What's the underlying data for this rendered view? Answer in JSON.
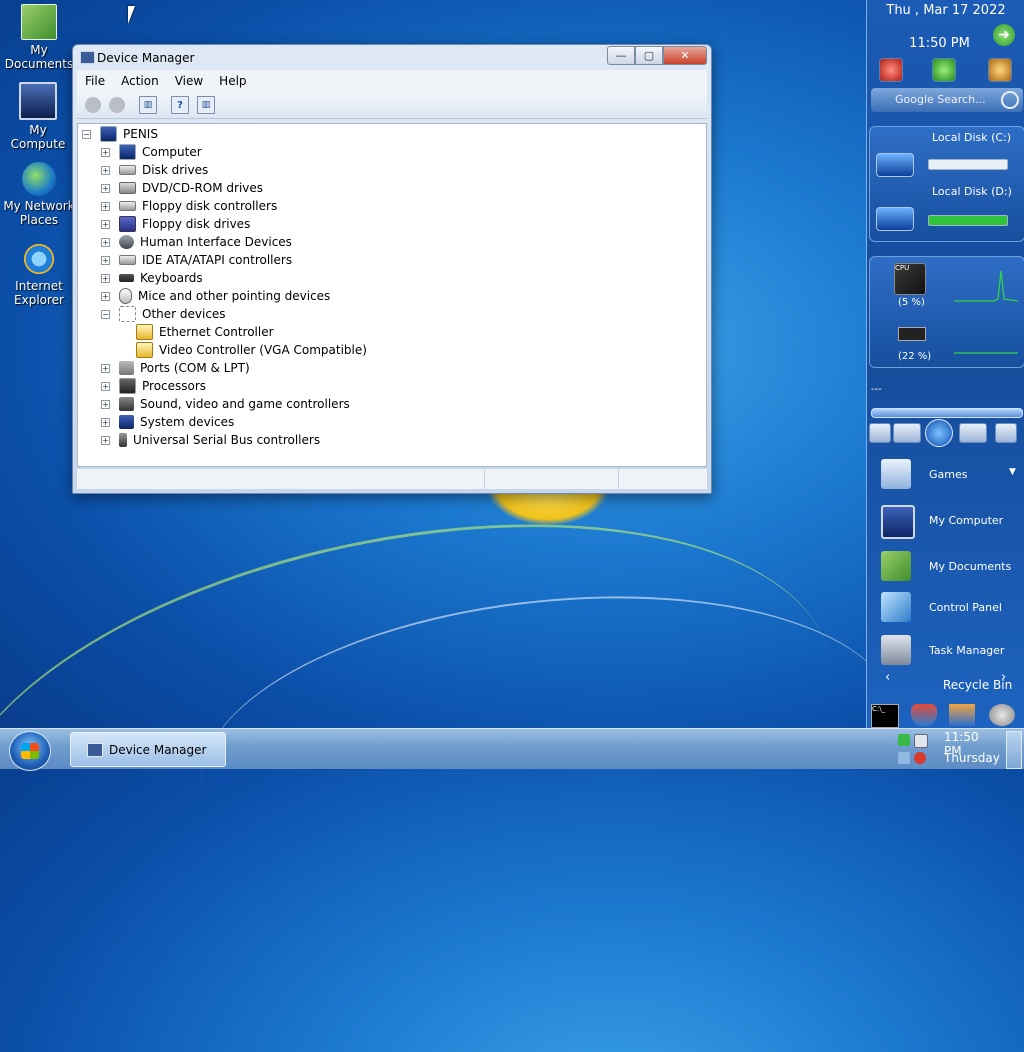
{
  "desktop": {
    "icons": [
      {
        "label": "My\nDocuments",
        "l1": "My",
        "l2": "Documents"
      },
      {
        "label": "My Computer",
        "l1": "My Compute",
        "l2": ""
      },
      {
        "label": "My Network Places",
        "l1": "My Network",
        "l2": "Places"
      },
      {
        "label": "Internet Explorer",
        "l1": "Internet",
        "l2": "Explorer"
      }
    ]
  },
  "window": {
    "title": "Device Manager",
    "controls": {
      "minimize": "—",
      "maximize": "▢",
      "close": "✕"
    },
    "menu": [
      "File",
      "Action",
      "View",
      "Help"
    ],
    "tree": {
      "root": "PENIS",
      "items": [
        {
          "label": "Computer",
          "expander": "+"
        },
        {
          "label": "Disk drives",
          "expander": "+"
        },
        {
          "label": "DVD/CD-ROM drives",
          "expander": "+"
        },
        {
          "label": "Floppy disk controllers",
          "expander": "+"
        },
        {
          "label": "Floppy disk drives",
          "expander": "+"
        },
        {
          "label": "Human Interface Devices",
          "expander": "+"
        },
        {
          "label": "IDE ATA/ATAPI controllers",
          "expander": "+"
        },
        {
          "label": "Keyboards",
          "expander": "+"
        },
        {
          "label": "Mice and other pointing devices",
          "expander": "+"
        },
        {
          "label": "Other devices",
          "expander": "−"
        },
        {
          "label": "Ethernet Controller",
          "child": true
        },
        {
          "label": "Video Controller (VGA Compatible)",
          "child": true
        },
        {
          "label": "Ports (COM & LPT)",
          "expander": "+"
        },
        {
          "label": "Processors",
          "expander": "+"
        },
        {
          "label": "Sound, video and game controllers",
          "expander": "+"
        },
        {
          "label": "System devices",
          "expander": "+"
        },
        {
          "label": "Universal Serial Bus controllers",
          "expander": "+"
        }
      ],
      "root_expander": "−"
    }
  },
  "sidebar": {
    "date": "Thu , Mar 17 2022",
    "time": "11:50 PM",
    "search_placeholder": "Google Search...",
    "disks": [
      {
        "label": "Local Disk (C:)",
        "used_fraction": 0.0
      },
      {
        "label": "Local Disk (D:)",
        "used_fraction": 1.0
      }
    ],
    "cpu_percent": "(5 %)",
    "mem_percent": "(22 %)",
    "cpu_chip_label": "CPU",
    "launcher": [
      {
        "label": "Games"
      },
      {
        "label": "My Computer"
      },
      {
        "label": "My Documents"
      },
      {
        "label": "Control Panel"
      },
      {
        "label": "Task Manager"
      },
      {
        "label": "Recycle Bin"
      }
    ],
    "player_title": "---"
  },
  "taskbar": {
    "task_label": "Device Manager",
    "time": "11:50 PM",
    "day": "Thursday"
  },
  "colors": {
    "desktop_blue": "#1b78cf",
    "sidebar_blue": "#174f9e",
    "disk_bar_green": "#2fc23a",
    "graph_green": "#35d14a"
  }
}
